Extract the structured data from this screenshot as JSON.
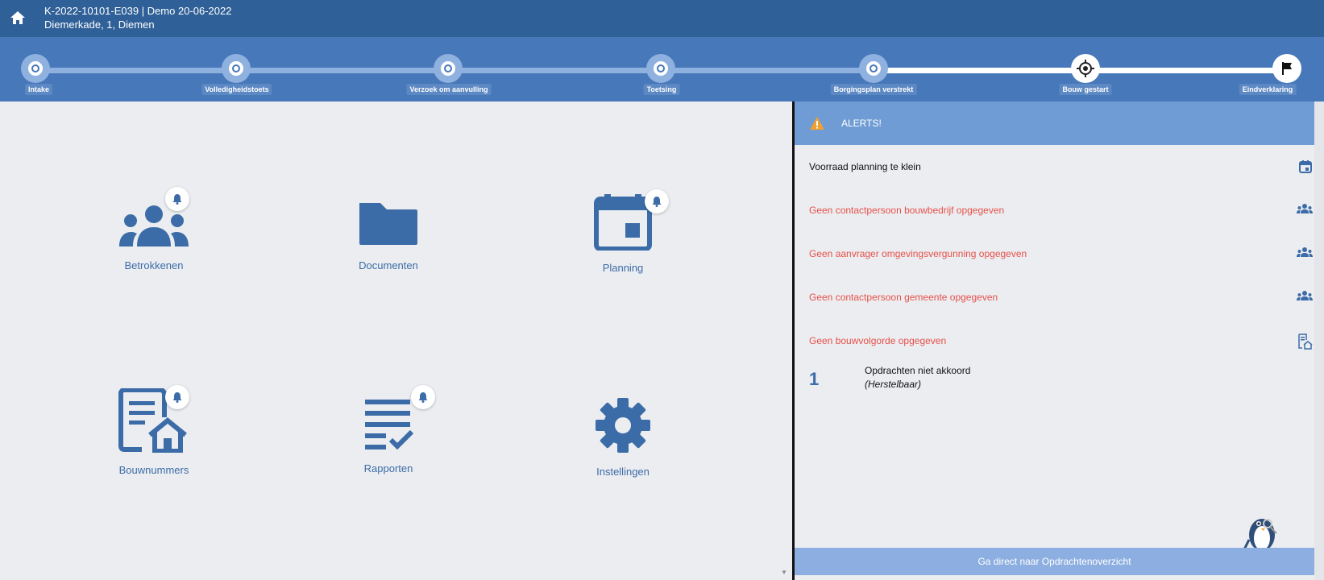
{
  "header": {
    "project_line1": "K-2022-10101-E039 | Demo 20-06-2022",
    "project_line2": "Diemerkade, 1, Diemen"
  },
  "steps": [
    {
      "label": "Intake",
      "state": "done"
    },
    {
      "label": "Volledigheidstoets",
      "state": "done"
    },
    {
      "label": "Verzoek om aanvulling",
      "state": "done"
    },
    {
      "label": "Toetsing",
      "state": "done"
    },
    {
      "label": "Borgingsplan verstrekt",
      "state": "done"
    },
    {
      "label": "Bouw gestart",
      "state": "current"
    },
    {
      "label": "Eindverklaring",
      "state": "final"
    }
  ],
  "tiles": [
    {
      "label": "Betrokkenen",
      "icon": "people-icon",
      "bell": true
    },
    {
      "label": "Documenten",
      "icon": "folder-icon",
      "bell": false
    },
    {
      "label": "Planning",
      "icon": "calendar-icon",
      "bell": true
    },
    {
      "label": "Bouwnummers",
      "icon": "document-house-icon",
      "bell": true
    },
    {
      "label": "Rapporten",
      "icon": "checklist-icon",
      "bell": true
    },
    {
      "label": "Instellingen",
      "icon": "gear-icon",
      "bell": false
    }
  ],
  "alerts": {
    "title": "ALERTS!",
    "items": [
      {
        "text": "Voorraad planning te klein",
        "color": "black",
        "icon": "calendar-icon"
      },
      {
        "text": "Geen contactpersoon bouwbedrijf opgegeven",
        "color": "red",
        "icon": "people-icon"
      },
      {
        "text": "Geen aanvrager omgevingsvergunning opgegeven",
        "color": "red",
        "icon": "people-icon"
      },
      {
        "text": "Geen contactpersoon gemeente opgegeven",
        "color": "red",
        "icon": "people-icon"
      },
      {
        "text": "Geen bouwvolgorde opgegeven",
        "color": "red",
        "icon": "document-house-icon"
      }
    ],
    "summary": {
      "count": "1",
      "line1": "Opdrachten niet akkoord",
      "line2": "(Herstelbaar)"
    },
    "button": "Ga direct naar Opdrachtenoverzicht"
  },
  "colors": {
    "primary": "#2f6097",
    "accent": "#4778b9",
    "alert_red": "#e8504a",
    "warning": "#f0a030"
  }
}
